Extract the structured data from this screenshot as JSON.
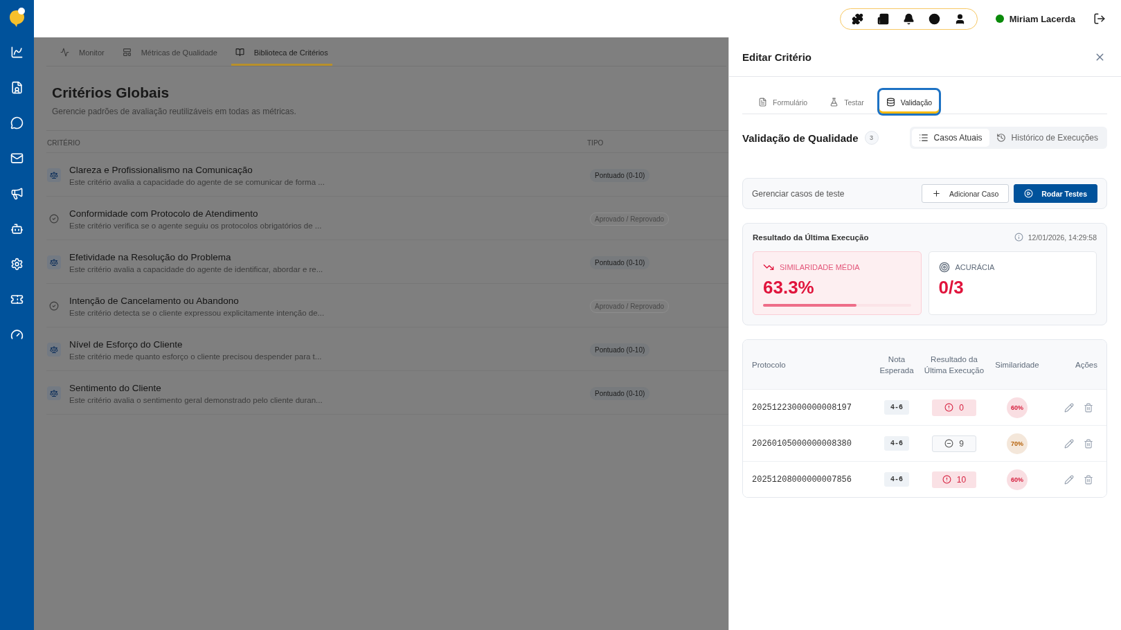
{
  "topbar": {
    "user": {
      "name": "Miriam Lacerda",
      "online": true
    }
  },
  "main": {
    "tabs": [
      {
        "label": "Monitor",
        "selected": false
      },
      {
        "label": "Métricas de Qualidade",
        "selected": false
      },
      {
        "label": "Biblioteca de Critérios",
        "selected": true
      }
    ],
    "title": "Critérios Globais",
    "subtitle": "Gerencie padrões de avaliação reutilizáveis em todas as métricas.",
    "table": {
      "columns": [
        "CRITÉRIO",
        "TIPO"
      ],
      "rows": [
        {
          "kind": "scored",
          "title": "Clareza e Profissionalismo na Comunicação",
          "description": "Este critério avalia a capacidade do agente de se comunicar de forma ...",
          "type": "Pontuado (0-10)"
        },
        {
          "kind": "pass_fail",
          "title": "Conformidade com Protocolo de Atendimento",
          "description": "Este critério verifica se o agente seguiu os protocolos obrigatórios de ...",
          "type": "Aprovado / Reprovado"
        },
        {
          "kind": "scored",
          "title": "Efetividade na Resolução do Problema",
          "description": "Este critério avalia a capacidade do agente de identificar, abordar e re...",
          "type": "Pontuado (0-10)"
        },
        {
          "kind": "pass_fail",
          "title": "Intenção de Cancelamento ou Abandono",
          "description": "Este critério detecta se o cliente expressou explicitamente intenção de...",
          "type": "Aprovado / Reprovado"
        },
        {
          "kind": "scored",
          "title": "Nível de Esforço do Cliente",
          "description": "Este critério mede quanto esforço o cliente precisou despender para t...",
          "type": "Pontuado (0-10)"
        },
        {
          "kind": "scored",
          "title": "Sentimento do Cliente",
          "description": "Este critério avalia o sentimento geral demonstrado pelo cliente duran...",
          "type": "Pontuado (0-10)"
        }
      ]
    }
  },
  "drawer": {
    "title": "Editar Critério",
    "tabs": [
      {
        "label": "Formulário",
        "selected": false
      },
      {
        "label": "Testar",
        "selected": false
      },
      {
        "label": "Validação",
        "selected": true
      }
    ],
    "section_title": "Validação de Qualidade",
    "count": "3",
    "views": [
      {
        "label": "Casos Atuais",
        "selected": true
      },
      {
        "label": "Histórico de Execuções",
        "selected": false
      }
    ],
    "manage": {
      "label": "Gerenciar casos de teste",
      "add_button": "Adicionar Caso",
      "run_button": "Rodar Testes"
    },
    "result": {
      "title": "Resultado da Última Execução",
      "timestamp": "12/01/2026, 14:29:58",
      "metrics": [
        {
          "kind": "similarity",
          "label": "SIMILARIDADE MÉDIA",
          "value": "63.3%",
          "level": 0.633
        },
        {
          "kind": "accuracy",
          "label": "ACURÁCIA",
          "value": "0/3"
        }
      ]
    },
    "cases": {
      "columns": [
        "Protocolo",
        "Nota Esperada",
        "Resultado da Última Execução",
        "Similaridade",
        "Ações"
      ],
      "rows": [
        {
          "protocol": "20251223000000008197",
          "expected": "4-6",
          "result": {
            "value": "0",
            "kind": "alert",
            "color": "#d6203f"
          },
          "similarity": {
            "value": "60%",
            "color": "#d6203f"
          }
        },
        {
          "protocol": "20260105000000008380",
          "expected": "4-6",
          "result": {
            "value": "9",
            "kind": "neutral",
            "color": "#555555"
          },
          "similarity": {
            "value": "70%",
            "color": "#b45f06"
          }
        },
        {
          "protocol": "20251208000000007856",
          "expected": "4-6",
          "result": {
            "value": "10",
            "kind": "alert",
            "color": "#d6203f"
          },
          "similarity": {
            "value": "60%",
            "color": "#d6203f"
          }
        }
      ]
    }
  }
}
